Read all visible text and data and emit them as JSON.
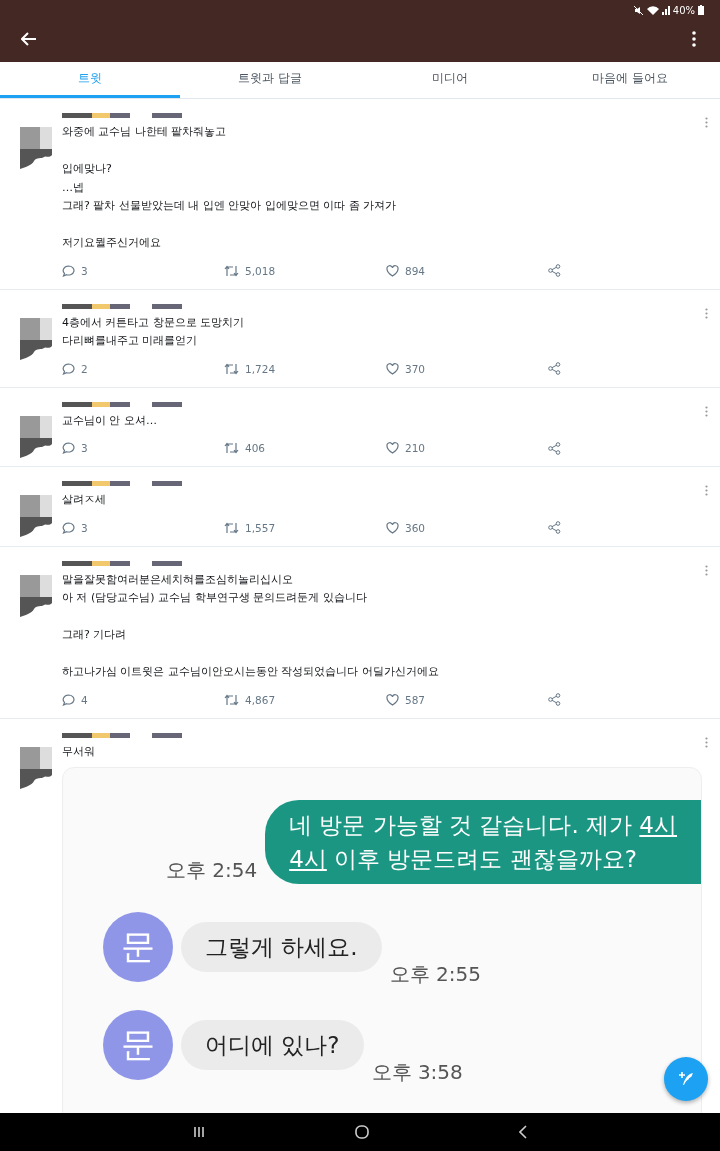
{
  "status_bar": {
    "battery": "40%"
  },
  "tabs": [
    {
      "label": "트윗",
      "selected": true
    },
    {
      "label": "트윗과 답글",
      "selected": false
    },
    {
      "label": "미디어",
      "selected": false
    },
    {
      "label": "마음에 들어요",
      "selected": false
    }
  ],
  "tweets": [
    {
      "text": "와중에 교수님 나한테 팥차줘놓고\n\n입에맞나?\n…넵\n그래? 팥차 선물받았는데 내 입엔 안맞아 입에맞으면 이따 좀 가져가\n\n저기요뭘주신거에요",
      "replies": "3",
      "retweets": "5,018",
      "likes": "894"
    },
    {
      "text": "4층에서 커튼타고 창문으로 도망치기\n다리뼈를내주고 미래를얻기",
      "replies": "2",
      "retweets": "1,724",
      "likes": "370"
    },
    {
      "text": "교수님이 안 오셔…",
      "replies": "3",
      "retweets": "406",
      "likes": "210"
    },
    {
      "text": "살려ㅈ세",
      "replies": "3",
      "retweets": "1,557",
      "likes": "360"
    },
    {
      "text": "말을잘못함여러분은세치혀를조심히놀리십시오\n아 저 (담당교수님) 교수님 학부연구생 문의드려둔게 있습니다\n\n그래? 기다려\n\n하고나가심 이트윗은 교수님이안오시는동안 작성되었습니다 어딜가신거에요",
      "replies": "4",
      "retweets": "4,867",
      "likes": "587"
    },
    {
      "text": "무서워",
      "chat": [
        {
          "kind": "sent",
          "time": "오후 2:54",
          "lines": [
            [
              {
                "text": "네 방문 가능할 것 같습니다. 제가 ",
                "underline": false
              },
              {
                "text": "4시",
                "underline": true
              }
            ],
            [
              {
                "text": "4시",
                "underline": true
              },
              {
                "text": " 이후 방문드려도 괜찮을까요?",
                "underline": false
              }
            ]
          ]
        },
        {
          "kind": "received",
          "avatar": "문",
          "time": "오후 2:55",
          "lines": [
            [
              {
                "text": "그렇게 하세요.",
                "underline": false
              }
            ]
          ]
        },
        {
          "kind": "received",
          "avatar": "문",
          "time": "오후 3:58",
          "lines": [
            [
              {
                "text": "어디에 있나?",
                "underline": false
              }
            ]
          ]
        }
      ]
    }
  ]
}
